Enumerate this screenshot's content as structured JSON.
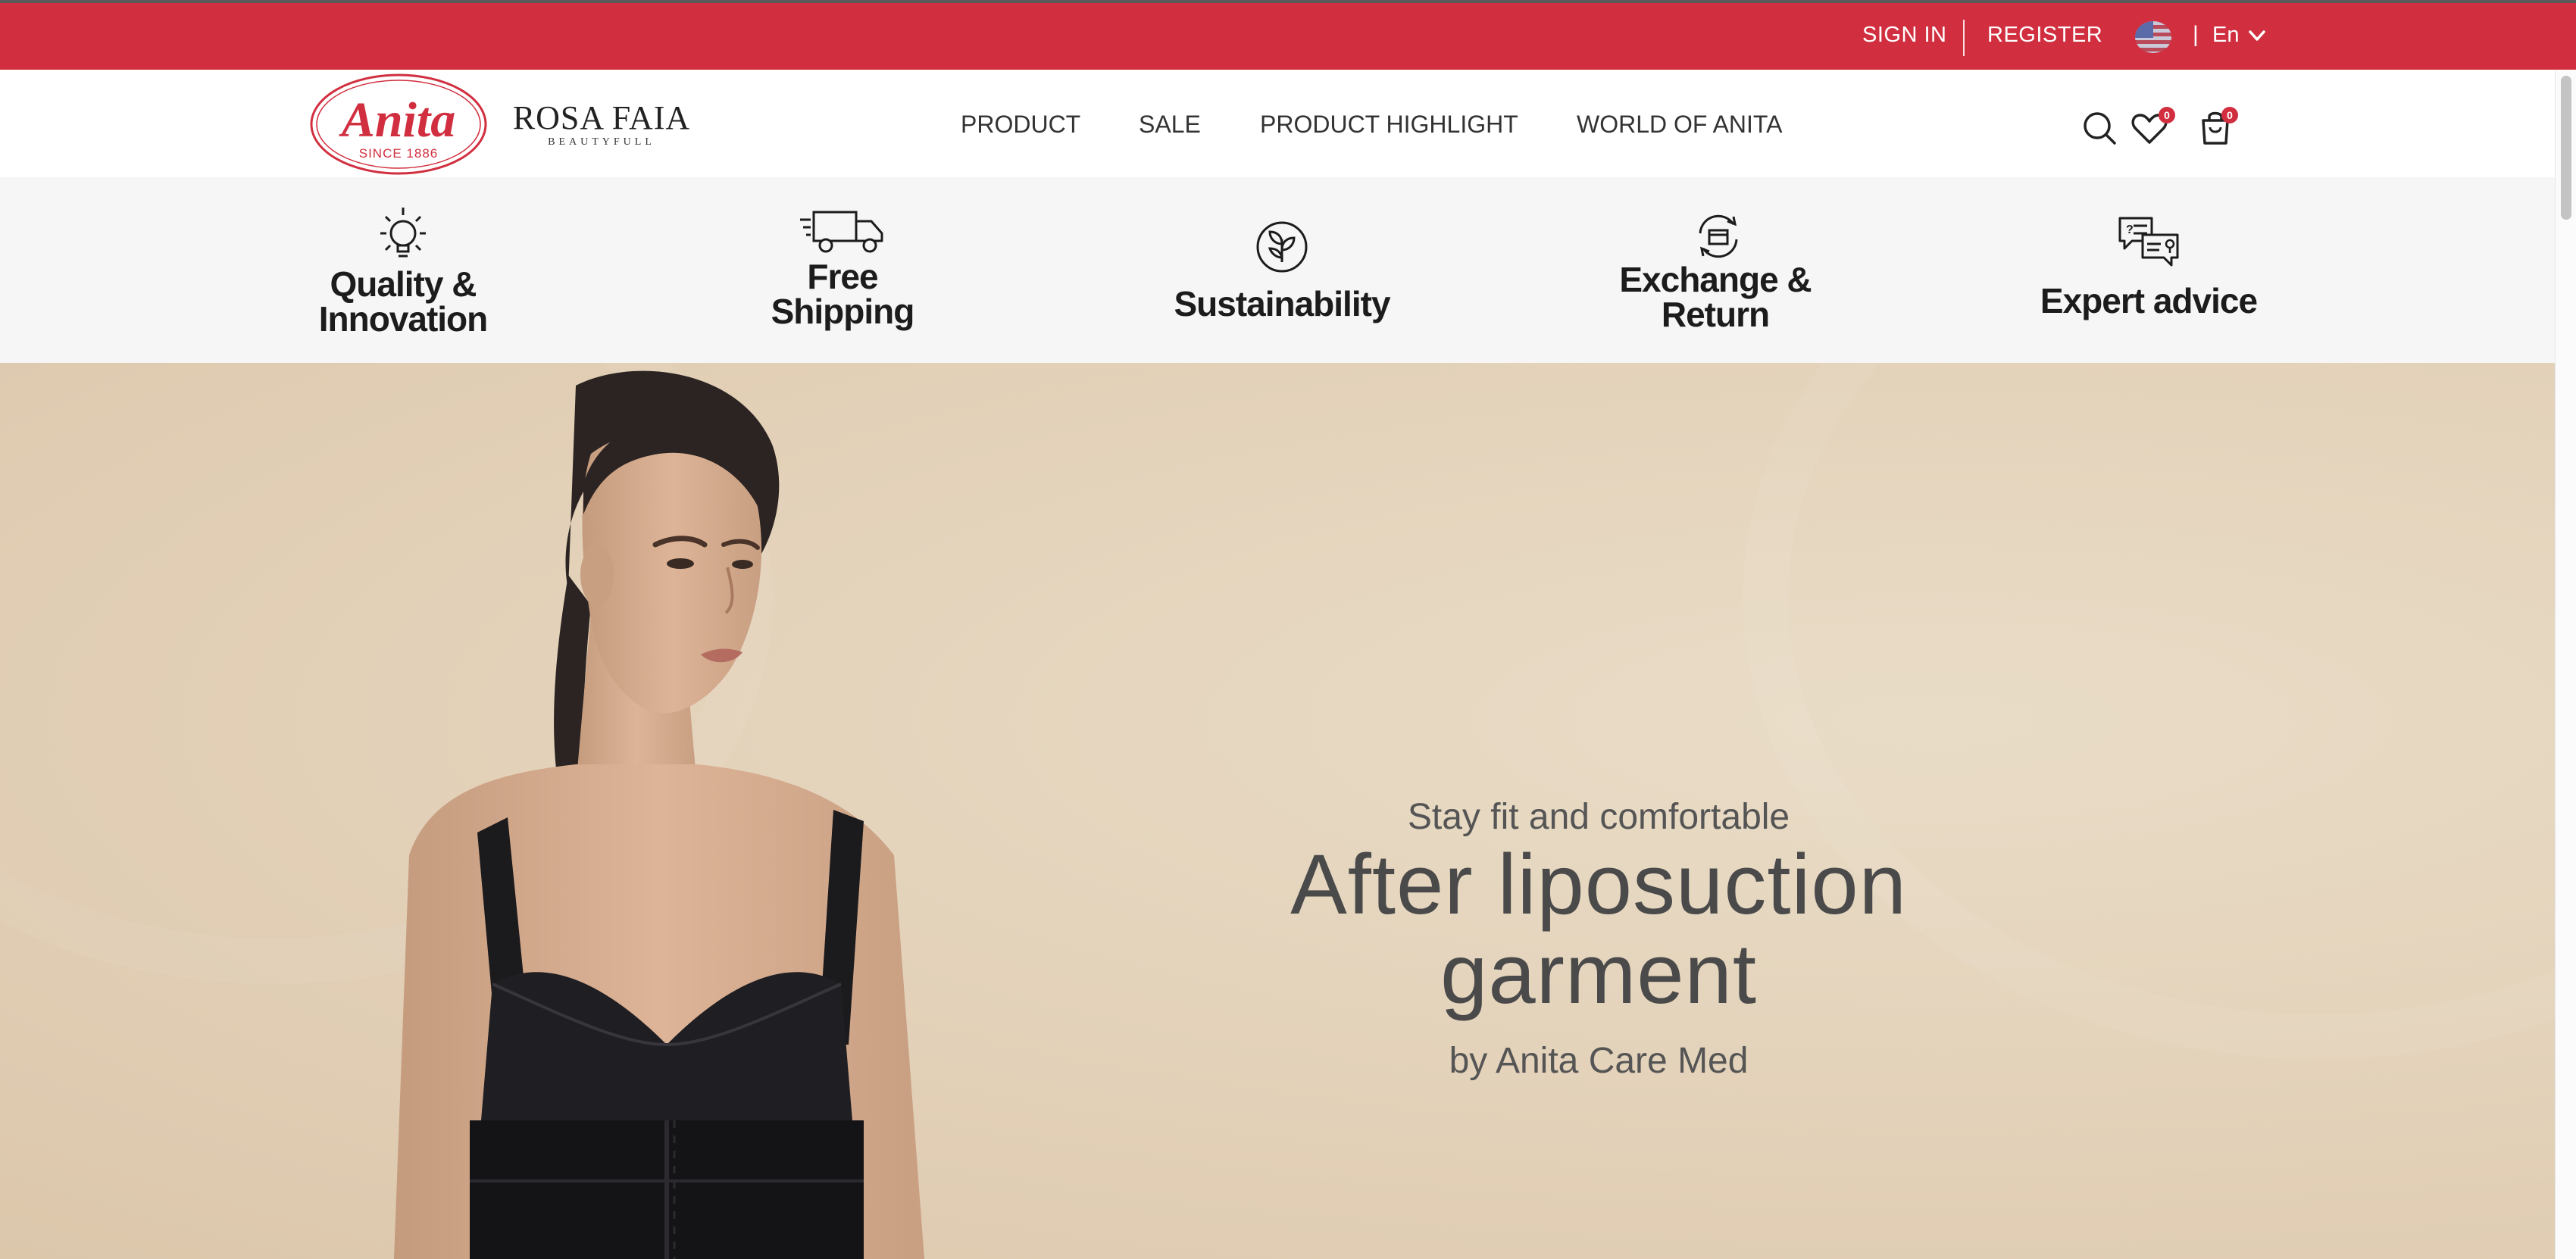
{
  "topbar": {
    "sign_in": "SIGN IN",
    "register": "REGISTER",
    "language": "En",
    "bg_color": "#d12f3f"
  },
  "header": {
    "anita_logo": {
      "name": "Anita",
      "tagline": "SINCE 1886"
    },
    "rosa_logo": {
      "name": "ROSA FAIA",
      "tagline": "BEAUTYFULL"
    },
    "nav": [
      "PRODUCT",
      "SALE",
      "PRODUCT HIGHLIGHT",
      "WORLD OF ANITA"
    ],
    "wishlist_count": "0",
    "cart_count": "0",
    "icons": [
      "search-icon",
      "heart-icon",
      "shopping-bag-icon"
    ]
  },
  "features": [
    {
      "line1": "Quality &",
      "line2": "Innovation",
      "icon": "lightbulb-icon"
    },
    {
      "line1": "Free",
      "line2": "Shipping",
      "icon": "delivery-truck-icon"
    },
    {
      "line1": "Sustainability",
      "line2": "",
      "icon": "leaves-icon"
    },
    {
      "line1": "Exchange &",
      "line2": "Return",
      "icon": "exchange-box-icon"
    },
    {
      "line1": "Expert advice",
      "line2": "",
      "icon": "chat-bubbles-icon"
    }
  ],
  "hero": {
    "subtitle": "Stay fit and comfortable",
    "title_line1": "After liposuction",
    "title_line2": "garment",
    "byline": "by Anita Care Med",
    "bg_color": "#e4d3bb"
  }
}
